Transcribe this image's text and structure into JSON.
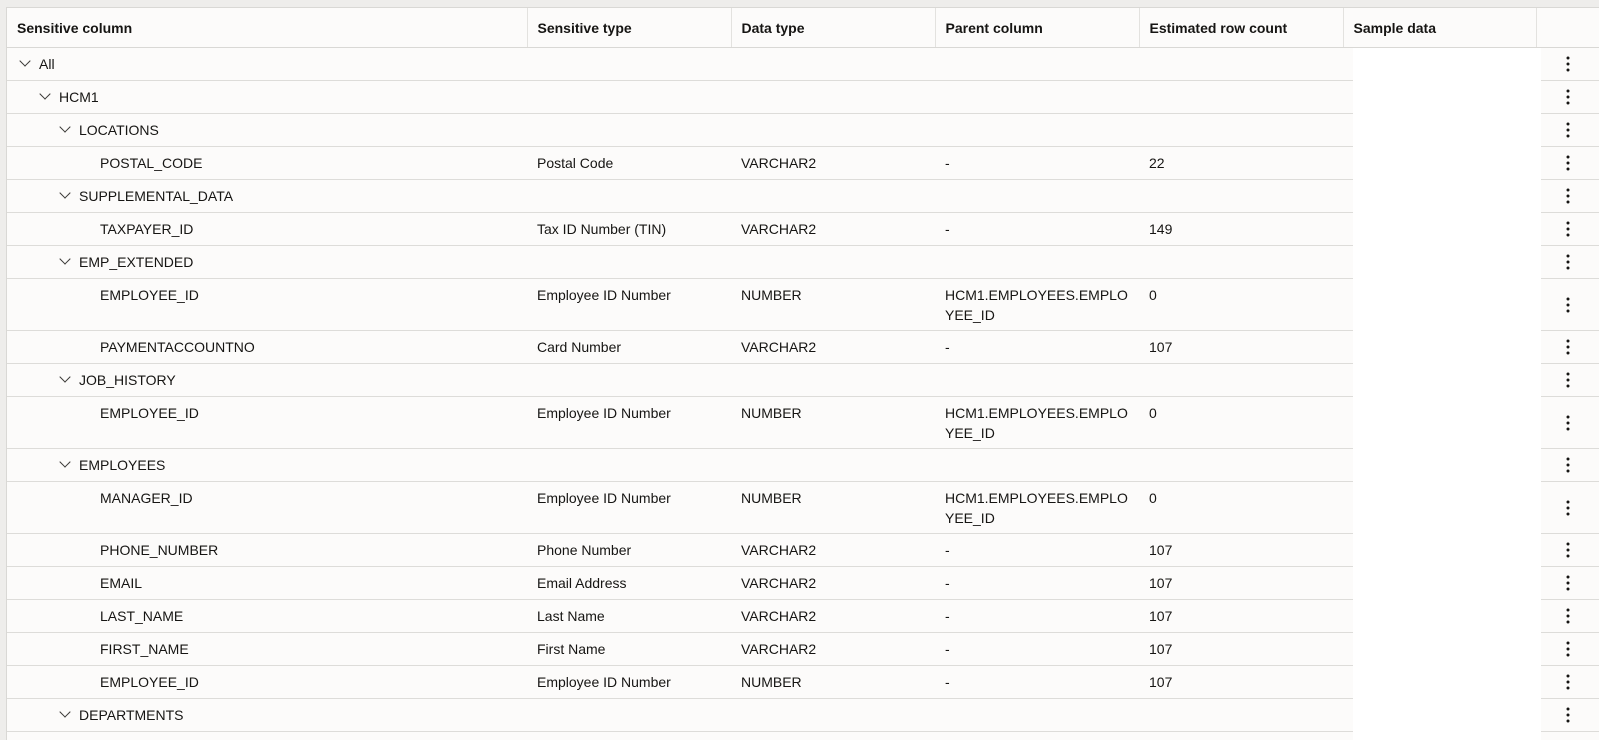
{
  "columns": [
    "Sensitive column",
    "Sensitive type",
    "Data type",
    "Parent column",
    "Estimated row count",
    "Sample data"
  ],
  "rows": [
    {
      "kind": "group",
      "level": 0,
      "name": "All"
    },
    {
      "kind": "group",
      "level": 1,
      "name": "HCM1"
    },
    {
      "kind": "group",
      "level": 2,
      "name": "LOCATIONS"
    },
    {
      "kind": "leaf",
      "name": "POSTAL_CODE",
      "sensitive_type": "Postal Code",
      "data_type": "VARCHAR2",
      "parent": "-",
      "rows": "22",
      "sample_visible": true
    },
    {
      "kind": "group",
      "level": 2,
      "name": "SUPPLEMENTAL_DATA"
    },
    {
      "kind": "leaf",
      "name": "TAXPAYER_ID",
      "sensitive_type": "Tax ID Number (TIN)",
      "data_type": "VARCHAR2",
      "parent": "-",
      "rows": "149",
      "sample_visible": true
    },
    {
      "kind": "group",
      "level": 2,
      "name": "EMP_EXTENDED"
    },
    {
      "kind": "leaf",
      "name": "EMPLOYEE_ID",
      "sensitive_type": "Employee ID Number",
      "data_type": "NUMBER",
      "parent": "HCM1.EMPLOYEES.EMPLO YEE_ID",
      "rows": "0",
      "sample_visible": false
    },
    {
      "kind": "leaf",
      "name": "PAYMENTACCOUNTNO",
      "sensitive_type": "Card Number",
      "data_type": "VARCHAR2",
      "parent": "-",
      "rows": "107",
      "sample_visible": true
    },
    {
      "kind": "group",
      "level": 2,
      "name": "JOB_HISTORY"
    },
    {
      "kind": "leaf",
      "name": "EMPLOYEE_ID",
      "sensitive_type": "Employee ID Number",
      "data_type": "NUMBER",
      "parent": "HCM1.EMPLOYEES.EMPLO YEE_ID",
      "rows": "0",
      "sample_visible": false
    },
    {
      "kind": "group",
      "level": 2,
      "name": "EMPLOYEES"
    },
    {
      "kind": "leaf",
      "name": "MANAGER_ID",
      "sensitive_type": "Employee ID Number",
      "data_type": "NUMBER",
      "parent": "HCM1.EMPLOYEES.EMPLO YEE_ID",
      "rows": "0",
      "sample_visible": false
    },
    {
      "kind": "leaf",
      "name": "PHONE_NUMBER",
      "sensitive_type": "Phone Number",
      "data_type": "VARCHAR2",
      "parent": "-",
      "rows": "107",
      "sample_visible": true
    },
    {
      "kind": "leaf",
      "name": "EMAIL",
      "sensitive_type": "Email Address",
      "data_type": "VARCHAR2",
      "parent": "-",
      "rows": "107",
      "sample_visible": true
    },
    {
      "kind": "leaf",
      "name": "LAST_NAME",
      "sensitive_type": "Last Name",
      "data_type": "VARCHAR2",
      "parent": "-",
      "rows": "107",
      "sample_visible": true
    },
    {
      "kind": "leaf",
      "name": "FIRST_NAME",
      "sensitive_type": "First Name",
      "data_type": "VARCHAR2",
      "parent": "-",
      "rows": "107",
      "sample_visible": true
    },
    {
      "kind": "leaf",
      "name": "EMPLOYEE_ID",
      "sensitive_type": "Employee ID Number",
      "data_type": "NUMBER",
      "parent": "-",
      "rows": "107",
      "sample_visible": true
    },
    {
      "kind": "group",
      "level": 2,
      "name": "DEPARTMENTS"
    }
  ],
  "icons": {
    "expand": "chevron-down-icon",
    "actions": "kebab-menu-icon"
  },
  "colors": {
    "background": "#fcfbfa",
    "border": "#dddcd9",
    "text": "#161513"
  }
}
